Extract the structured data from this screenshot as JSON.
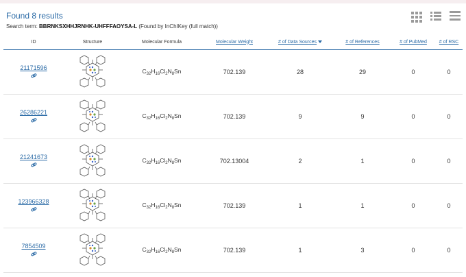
{
  "header": {
    "results_title": "Found 8 results",
    "search_label": "Search term:",
    "search_term": "BBRNKSXHHJRNHK-UHFFFAOYSA-L",
    "search_note": "(Found by InChIKey (full match))"
  },
  "toolbar": {
    "views": [
      {
        "name": "grid-view-icon"
      },
      {
        "name": "list-view-icon"
      },
      {
        "name": "menu-icon"
      }
    ]
  },
  "table": {
    "columns": {
      "id": "ID",
      "structure": "Structure",
      "formula": "Molecular Formula",
      "weight": "Molecular Weight",
      "sources": "# of Data Sources",
      "references": "# of References",
      "pubmed": "# of PubMed",
      "rsc": "# of RSC"
    },
    "rows": [
      {
        "id": "21171596",
        "formula": {
          "c": "C",
          "c_n": "32",
          "h": "H",
          "h_n": "16",
          "cl": "Cl",
          "cl_n": "2",
          "n": "N",
          "n_n": "8",
          "sn": "Sn"
        },
        "weight": "702.139",
        "sources": "28",
        "references": "29",
        "pubmed": "0",
        "rsc": "0"
      },
      {
        "id": "26286221",
        "formula": {
          "c": "C",
          "c_n": "32",
          "h": "H",
          "h_n": "16",
          "cl": "Cl",
          "cl_n": "2",
          "n": "N",
          "n_n": "8",
          "sn": "Sn"
        },
        "weight": "702.139",
        "sources": "9",
        "references": "9",
        "pubmed": "0",
        "rsc": "0"
      },
      {
        "id": "21241673",
        "formula": {
          "c": "C",
          "c_n": "32",
          "h": "H",
          "h_n": "16",
          "cl": "Cl",
          "cl_n": "2",
          "n": "N",
          "n_n": "8",
          "sn": "Sn"
        },
        "weight": "702.13004",
        "sources": "2",
        "references": "1",
        "pubmed": "0",
        "rsc": "0"
      },
      {
        "id": "123966328",
        "formula": {
          "c": "C",
          "c_n": "32",
          "h": "H",
          "h_n": "16",
          "cl": "Cl",
          "cl_n": "2",
          "n": "N",
          "n_n": "8",
          "sn": "Sn"
        },
        "weight": "702.139",
        "sources": "1",
        "references": "1",
        "pubmed": "0",
        "rsc": "0"
      },
      {
        "id": "7854509",
        "formula": {
          "c": "C",
          "c_n": "32",
          "h": "H",
          "h_n": "16",
          "cl": "Cl",
          "cl_n": "2",
          "n": "N",
          "n_n": "8",
          "sn": "Sn"
        },
        "weight": "702.139",
        "sources": "1",
        "references": "3",
        "pubmed": "0",
        "rsc": "0"
      }
    ]
  }
}
